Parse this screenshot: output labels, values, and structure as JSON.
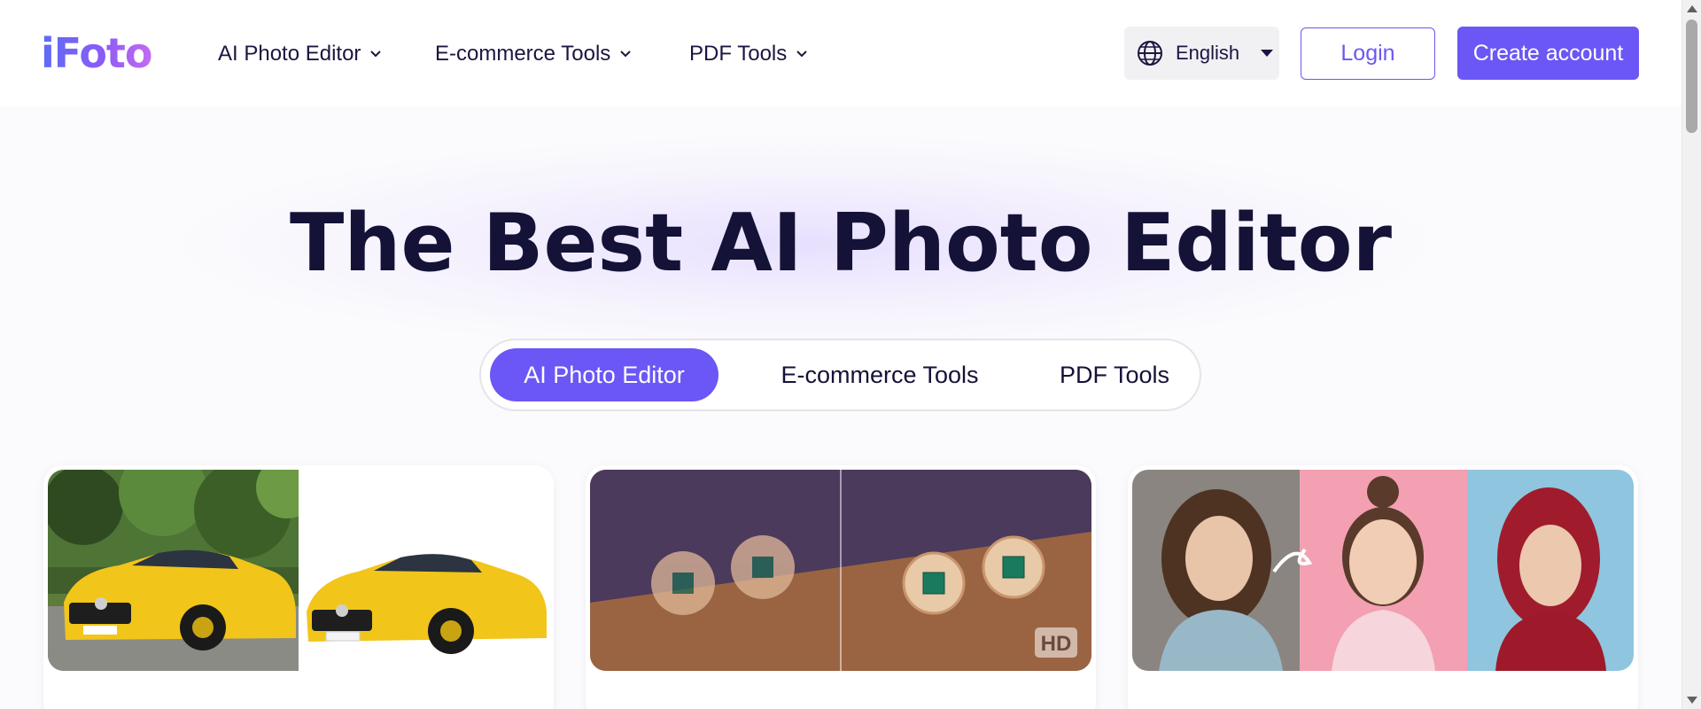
{
  "brand": {
    "logo_text": "iFoto"
  },
  "nav": {
    "items": [
      {
        "label": "AI Photo Editor"
      },
      {
        "label": "E-commerce Tools"
      },
      {
        "label": "PDF Tools"
      }
    ]
  },
  "header": {
    "language": "English",
    "login_label": "Login",
    "create_account_label": "Create account"
  },
  "hero": {
    "title": "The Best AI Photo Editor",
    "tabs": [
      {
        "label": "AI Photo Editor",
        "active": true
      },
      {
        "label": "E-commerce Tools",
        "active": false
      },
      {
        "label": "PDF Tools",
        "active": false
      }
    ]
  },
  "cards": [
    {
      "image": "yellow sports car before/after background removal"
    },
    {
      "image": "emerald earrings photo enhancer",
      "badge": "HD"
    },
    {
      "image": "portrait AI headshot transformation"
    }
  ],
  "colors": {
    "accent": "#6b57f5",
    "title": "#151238",
    "text": "#1b1640"
  }
}
